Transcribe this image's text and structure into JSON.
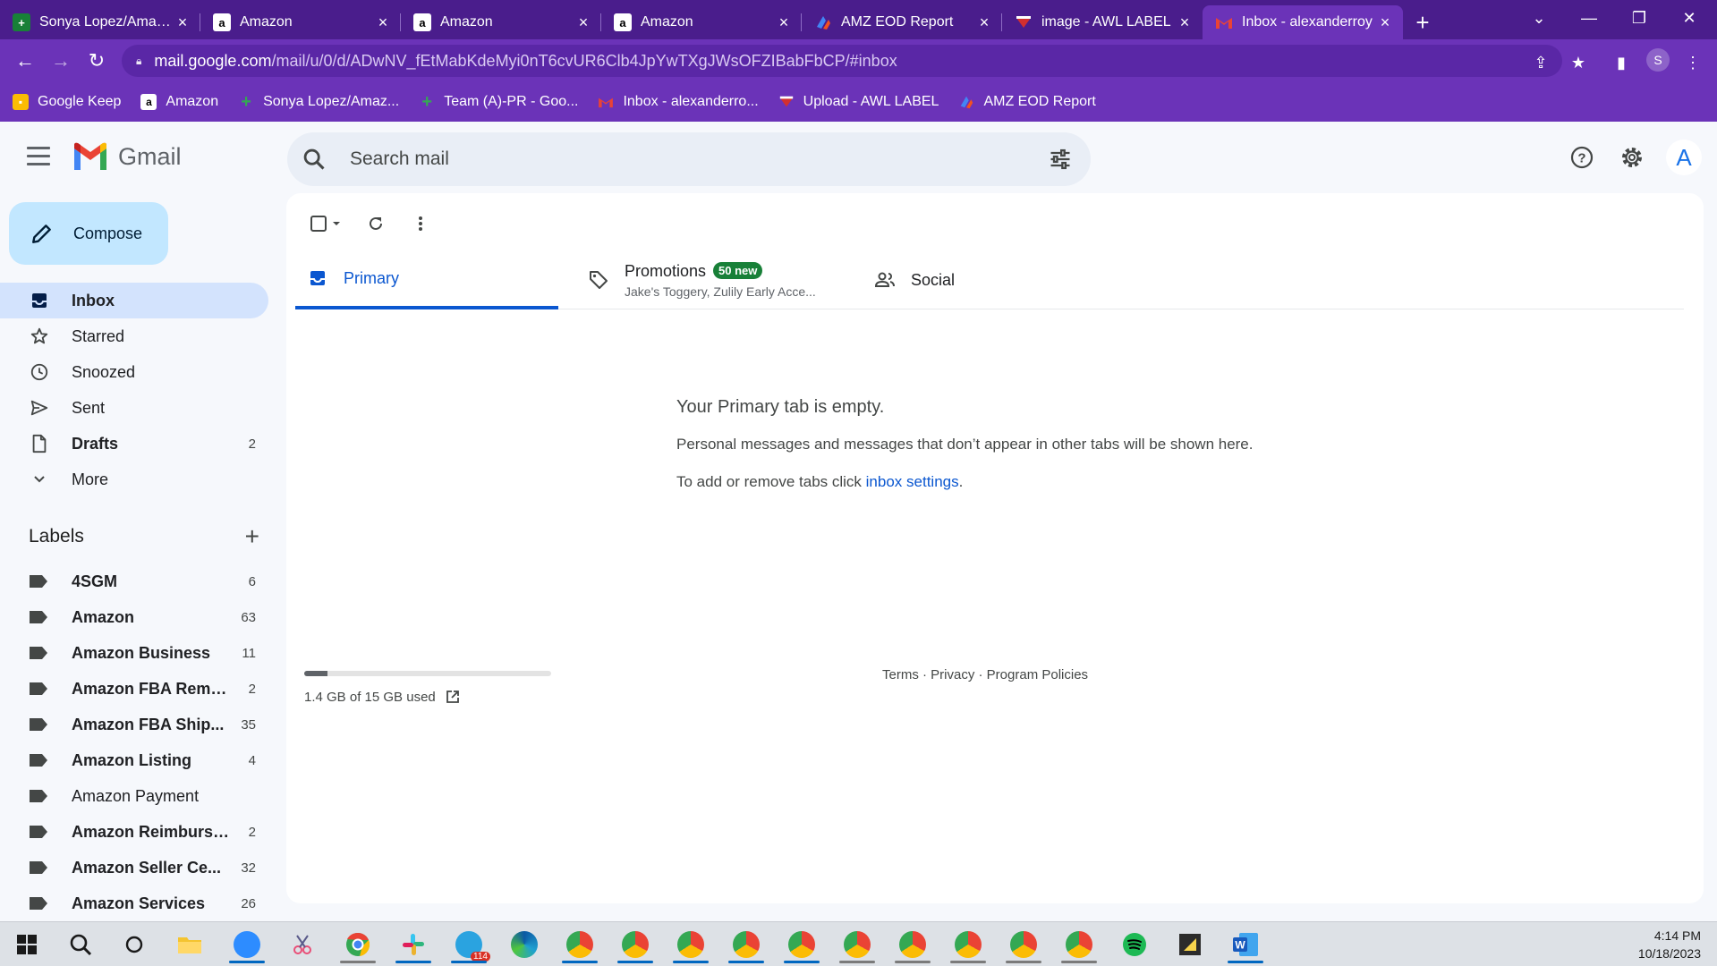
{
  "browser": {
    "tabs": [
      {
        "label": "Sonya Lopez/Amazon",
        "icon": "plus-cross-icon",
        "active": false
      },
      {
        "label": "Amazon",
        "icon": "amazon-icon",
        "active": false
      },
      {
        "label": "Amazon",
        "icon": "amazon-icon",
        "active": false
      },
      {
        "label": "Amazon",
        "icon": "amazon-icon",
        "active": false
      },
      {
        "label": "AMZ EOD Report",
        "icon": "report-icon",
        "active": false
      },
      {
        "label": "image - AWL LABEL",
        "icon": "label-icon",
        "active": false
      },
      {
        "label": "Inbox - alexanderroy",
        "icon": "gmail-icon",
        "active": true
      }
    ],
    "url_host": "mail.google.com",
    "url_path": "/mail/u/0/d/ADwNV_fEtMabKdeMyi0nT6cvUR6Clb4JpYwTXgJWsOFZIBabFbCP/#inbox",
    "profile_initial": "S",
    "bookmarks": [
      {
        "label": "Google Keep",
        "icon": "keep-icon"
      },
      {
        "label": "Amazon",
        "icon": "amazon-icon"
      },
      {
        "label": "Sonya Lopez/Amaz...",
        "icon": "plus-cross-icon"
      },
      {
        "label": "Team (A)-PR - Goo...",
        "icon": "plus-cross-icon"
      },
      {
        "label": "Inbox - alexanderro...",
        "icon": "gmail-icon"
      },
      {
        "label": "Upload - AWL LABEL",
        "icon": "label-icon"
      },
      {
        "label": "AMZ EOD Report",
        "icon": "report-icon"
      }
    ]
  },
  "gmail": {
    "brand": "Gmail",
    "search_placeholder": "Search mail",
    "avatar_initial": "A",
    "compose_label": "Compose",
    "nav": [
      {
        "label": "Inbox",
        "icon": "inbox-icon",
        "count": "",
        "active": true,
        "bold": true
      },
      {
        "label": "Starred",
        "icon": "star-icon",
        "count": "",
        "active": false,
        "bold": false
      },
      {
        "label": "Snoozed",
        "icon": "clock-icon",
        "count": "",
        "active": false,
        "bold": false
      },
      {
        "label": "Sent",
        "icon": "send-icon",
        "count": "",
        "active": false,
        "bold": false
      },
      {
        "label": "Drafts",
        "icon": "draft-icon",
        "count": "2",
        "active": false,
        "bold": true
      },
      {
        "label": "More",
        "icon": "chevron-down-icon",
        "count": "",
        "active": false,
        "bold": false
      }
    ],
    "labels_heading": "Labels",
    "labels": [
      {
        "name": "4SGM",
        "count": "6",
        "bold": true
      },
      {
        "name": "Amazon",
        "count": "63",
        "bold": true
      },
      {
        "name": "Amazon Business",
        "count": "11",
        "bold": true
      },
      {
        "name": "Amazon FBA Remo...",
        "count": "2",
        "bold": true
      },
      {
        "name": "Amazon FBA Ship...",
        "count": "35",
        "bold": true
      },
      {
        "name": "Amazon Listing",
        "count": "4",
        "bold": true
      },
      {
        "name": "Amazon Payment",
        "count": "",
        "bold": false
      },
      {
        "name": "Amazon Reimburse...",
        "count": "2",
        "bold": true
      },
      {
        "name": "Amazon Seller Ce...",
        "count": "32",
        "bold": true
      },
      {
        "name": "Amazon Services",
        "count": "26",
        "bold": true
      }
    ],
    "tabs": {
      "primary": "Primary",
      "promotions": "Promotions",
      "promotions_badge": "50 new",
      "promotions_sub": "Jake's Toggery, Zulily Early Acce...",
      "social": "Social"
    },
    "empty_title": "Your Primary tab is empty.",
    "empty_line1": "Personal messages and messages that don’t appear in other tabs will be shown here.",
    "empty_line2_prefix": "To add or remove tabs click ",
    "empty_line2_link": "inbox settings",
    "empty_line2_suffix": ".",
    "storage_text": "1.4 GB of 15 GB used",
    "storage_fraction": 0.093,
    "footer": "Terms · Privacy · Program Policies"
  },
  "taskbar": {
    "time": "4:14 PM",
    "date": "10/18/2023",
    "telegram_badge": "114",
    "apps": [
      "windows-start-icon",
      "search-icon",
      "task-view-icon",
      "file-explorer-icon",
      "zoom-icon",
      "snip-icon",
      "chrome-icon",
      "slack-icon",
      "telegram-icon",
      "edge-icon",
      "chrome-icon",
      "chrome-icon",
      "chrome-icon",
      "chrome-icon",
      "chrome-icon",
      "chrome-icon",
      "chrome-icon",
      "chrome-icon",
      "chrome-icon",
      "spotify-icon",
      "sticky-notes-icon",
      "word-icon"
    ]
  },
  "colors": {
    "chrome_frame": "#4a1d8c",
    "chrome_toolbar": "#6b33b8",
    "compose_bg": "#c2e7ff",
    "active_nav": "#d3e3fd",
    "primary_accent": "#0b57d0",
    "badge_green": "#188038"
  }
}
